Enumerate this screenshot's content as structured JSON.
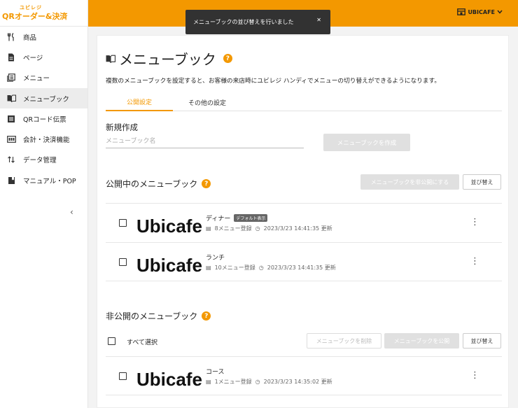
{
  "header": {
    "logo_small": "ユビレジ",
    "logo_main": "QRオーダー&決済",
    "account": "UBICAFE",
    "account_icon": "store-icon",
    "accent_color": "#f39800"
  },
  "toast": {
    "message": "メニューブックの並び替えを行いました",
    "close": "✕"
  },
  "sidebar": {
    "items": [
      {
        "label": "商品",
        "icon": "cutlery-icon"
      },
      {
        "label": "ページ",
        "icon": "page-icon"
      },
      {
        "label": "メニュー",
        "icon": "menu-list-icon"
      },
      {
        "label": "メニューブック",
        "icon": "book-icon",
        "active": true
      },
      {
        "label": "QRコード伝票",
        "icon": "receipt-icon"
      },
      {
        "label": "会計・決済機能",
        "icon": "payment-icon"
      },
      {
        "label": "データ管理",
        "icon": "sort-arrows-icon"
      },
      {
        "label": "マニュアル・POP",
        "icon": "manual-icon"
      }
    ],
    "collapse": "‹"
  },
  "page": {
    "title": "メニューブック",
    "description": "複数のメニューブックを設定すると、お客様の来店時にユビレジ ハンディでメニューの切り替えができるようになります。",
    "tabs": [
      "公開設定",
      "その他の設定"
    ],
    "new": {
      "title": "新規作成",
      "placeholder": "メニューブック名",
      "create_button": "メニューブックを作成"
    },
    "published": {
      "title": "公開中のメニューブック",
      "unpublish_button": "メニューブックを非公開にする",
      "sort_button": "並び替え",
      "books": [
        {
          "name": "ディナー",
          "badge": "デフォルト表示",
          "count": "8メニュー登録",
          "updated": "2023/3/23 14:41:35 更新"
        },
        {
          "name": "ランチ",
          "badge": "",
          "count": "10メニュー登録",
          "updated": "2023/3/23 14:41:35 更新"
        }
      ]
    },
    "unpublished": {
      "title": "非公開のメニューブック",
      "select_all": "すべて選択",
      "delete_button": "メニューブックを削除",
      "publish_button": "メニューブックを公開",
      "sort_button": "並び替え",
      "books": [
        {
          "name": "コース",
          "badge": "",
          "count": "1メニュー登録",
          "updated": "2023/3/23 14:35:02 更新"
        }
      ]
    },
    "brand_text": "Ubicafe"
  }
}
